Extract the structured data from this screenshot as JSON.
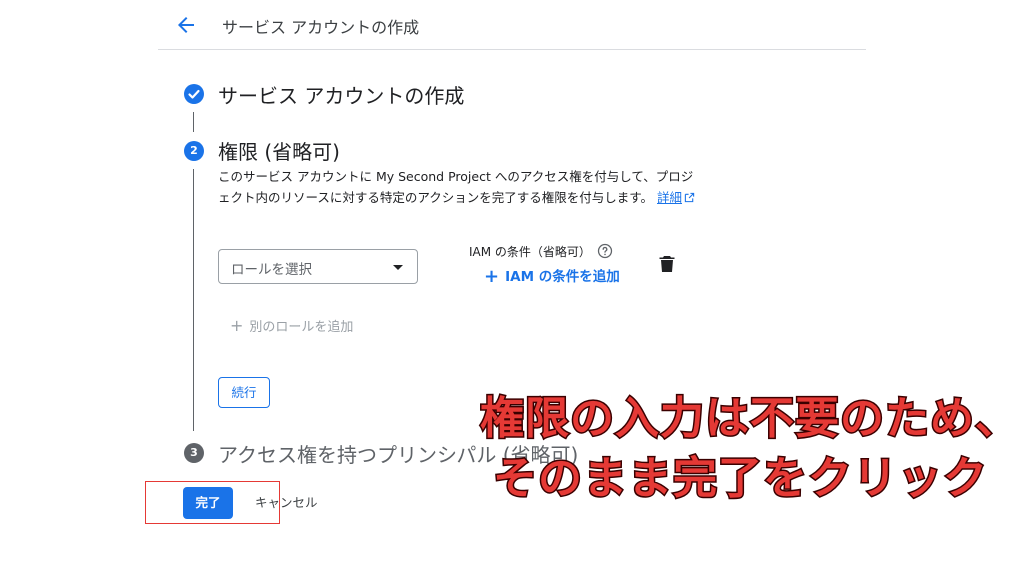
{
  "header": {
    "title": "サービス アカウントの作成"
  },
  "steps": [
    {
      "number": "",
      "title": "サービス アカウントの作成",
      "status": "done"
    },
    {
      "number": "2",
      "title": "権限 (省略可)",
      "status": "active"
    },
    {
      "number": "3",
      "title": "アクセス権を持つプリンシパル (省略可)",
      "status": "pending"
    }
  ],
  "permissions": {
    "description": "このサービス アカウントに My Second Project へのアクセス権を付与して、プロジェクト内のリソースに対する特定のアクションを完了する権限を付与します。",
    "link_label": "詳細",
    "role_placeholder": "ロールを選択",
    "iam_condition_label": "IAM の条件（省略可）",
    "add_iam_condition": "IAM の条件を追加",
    "add_role": "別のロールを追加",
    "continue": "続行"
  },
  "footer": {
    "done": "完了",
    "cancel": "キャンセル"
  },
  "annotation": {
    "line1": "権限の入力は不要のため、",
    "line2": "そのまま完了をクリック"
  },
  "colors": {
    "accent": "#1a73e8",
    "annotation": "#e53935"
  },
  "icons": [
    "back-arrow-icon",
    "check-icon",
    "external-link-icon",
    "help-icon",
    "trash-icon",
    "plus-icon",
    "dropdown-caret-icon"
  ]
}
